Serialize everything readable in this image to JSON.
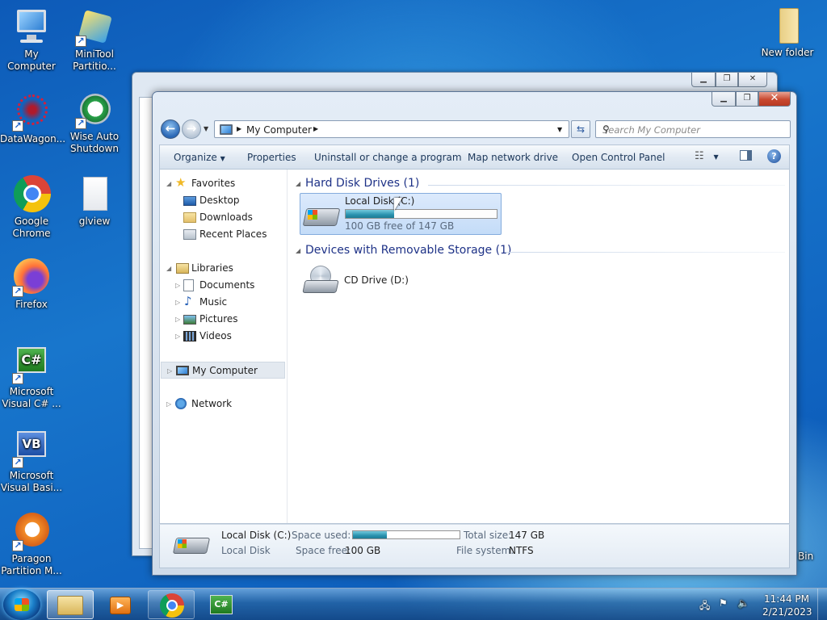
{
  "desktop": {
    "icons": [
      {
        "label": "My Computer",
        "icon": "computer-icon"
      },
      {
        "label": "MiniTool Partitio...",
        "icon": "minitool-icon"
      },
      {
        "label": "DataWagon...",
        "icon": "datawagon-icon"
      },
      {
        "label": "Wise Auto Shutdown",
        "icon": "wise-shutdown-icon"
      },
      {
        "label": "Google Chrome",
        "icon": "chrome-icon"
      },
      {
        "label": "glview",
        "icon": "document-icon"
      },
      {
        "label": "Firefox",
        "icon": "firefox-icon"
      },
      {
        "label": "Microsoft Visual C# ...",
        "icon": "visual-csharp-icon"
      },
      {
        "label": "Microsoft Visual Basi...",
        "icon": "visual-basic-icon"
      },
      {
        "label": "Paragon Partition M...",
        "icon": "paragon-icon"
      },
      {
        "label": "New folder",
        "icon": "folder-icon"
      },
      {
        "label": "Bin",
        "icon": "recycle-bin-icon"
      }
    ]
  },
  "explorer": {
    "address": {
      "crumb": "My Computer"
    },
    "search": {
      "placeholder": "Search My Computer"
    },
    "toolbar": {
      "organize": "Organize",
      "properties": "Properties",
      "uninstall": "Uninstall or change a program",
      "map_drive": "Map network drive",
      "control_panel": "Open Control Panel"
    },
    "nav": {
      "favorites": "Favorites",
      "desktop": "Desktop",
      "downloads": "Downloads",
      "recent": "Recent Places",
      "libraries": "Libraries",
      "documents": "Documents",
      "music": "Music",
      "pictures": "Pictures",
      "videos": "Videos",
      "my_computer": "My Computer",
      "network": "Network"
    },
    "groups": {
      "hdd": "Hard Disk Drives (1)",
      "removable": "Devices with Removable Storage (1)"
    },
    "drives": {
      "c": {
        "name": "Local Disk (C:)",
        "free_text": "100 GB free of 147 GB",
        "used_fraction": 0.32
      },
      "d": {
        "name": "CD Drive (D:)"
      }
    },
    "details": {
      "name": "Local Disk (C:)",
      "type": "Local Disk",
      "space_used_label": "Space used:",
      "space_free_label": "Space free:",
      "space_free": "100 GB",
      "total_size_label": "Total size:",
      "total_size": "147 GB",
      "fs_label": "File system:",
      "fs": "NTFS"
    }
  },
  "taskbar": {
    "time": "11:44 PM",
    "date": "2/21/2023",
    "items": [
      "explorer-icon",
      "media-player-icon",
      "chrome-icon",
      "visual-csharp-icon"
    ]
  },
  "colors": {
    "accent": "#1e3287",
    "selection": "#c4dcf8",
    "close": "#c8482f"
  }
}
